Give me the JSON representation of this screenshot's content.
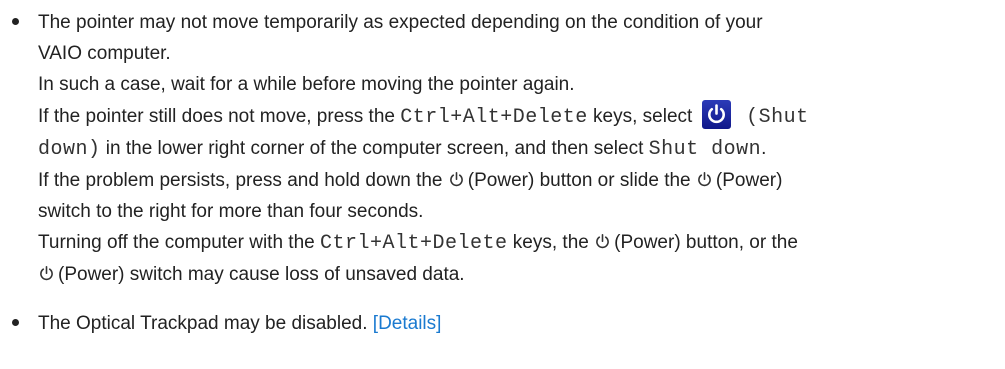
{
  "tips": [
    {
      "lines": {
        "l1": "The pointer may not move temporarily as expected depending on the condition of your",
        "l2": "VAIO computer.",
        "l3": "In such a case, wait for a while before moving the pointer again.",
        "l4a": "If the pointer still does not move, press the ",
        "l4b": "Ctrl+Alt+Delete",
        "l4c": " keys, select ",
        "l4d": " (Shut",
        "l5a": "down)",
        "l5b": " in the lower right corner of the computer screen, and then select ",
        "l5c": "Shut down",
        "l5d": ".",
        "l6a": "If the problem persists, press and hold down the ",
        "l6b": "(Power) button or slide the ",
        "l6c": "(Power)",
        "l7": "switch to the right for more than four seconds.",
        "l8a": "Turning off the computer with the ",
        "l8b": "Ctrl+Alt+Delete",
        "l8c": " keys, the ",
        "l8d": "(Power) button, or the",
        "l9a": "(Power) switch may cause loss of unsaved data."
      }
    },
    {
      "lines": {
        "l1a": "The Optical Trackpad may be disabled. ",
        "l1b": "[Details]"
      }
    }
  ],
  "icons": {
    "power": "power-icon",
    "shut_down": "shut-down-icon"
  },
  "colors": {
    "text": "#222222",
    "link": "#1a7ad0",
    "shut_down_icon_bg": "#1e28a0"
  }
}
